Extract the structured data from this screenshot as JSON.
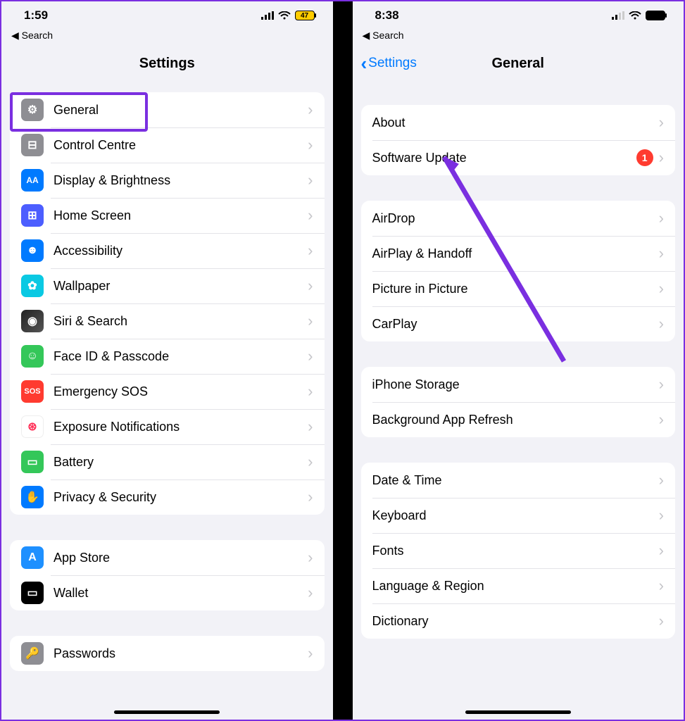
{
  "left": {
    "status": {
      "time": "1:59",
      "battery_label": "47"
    },
    "back_search": "◀ Search",
    "title": "Settings",
    "sections": [
      [
        {
          "label": "General",
          "icon": "gear"
        },
        {
          "label": "Control Centre",
          "icon": "cc"
        },
        {
          "label": "Display & Brightness",
          "icon": "disp"
        },
        {
          "label": "Home Screen",
          "icon": "home"
        },
        {
          "label": "Accessibility",
          "icon": "acc"
        },
        {
          "label": "Wallpaper",
          "icon": "wall"
        },
        {
          "label": "Siri & Search",
          "icon": "siri"
        },
        {
          "label": "Face ID & Passcode",
          "icon": "face"
        },
        {
          "label": "Emergency SOS",
          "icon": "sos"
        },
        {
          "label": "Exposure Notifications",
          "icon": "expo"
        },
        {
          "label": "Battery",
          "icon": "batt"
        },
        {
          "label": "Privacy & Security",
          "icon": "priv"
        }
      ],
      [
        {
          "label": "App Store",
          "icon": "app"
        },
        {
          "label": "Wallet",
          "icon": "wallet"
        }
      ],
      [
        {
          "label": "Passwords",
          "icon": "pass"
        }
      ]
    ]
  },
  "right": {
    "status": {
      "time": "8:38"
    },
    "back_search": "◀ Search",
    "back_button": "Settings",
    "title": "General",
    "badge_count": "1",
    "sections": [
      [
        {
          "label": "About"
        },
        {
          "label": "Software Update",
          "badge": true
        }
      ],
      [
        {
          "label": "AirDrop"
        },
        {
          "label": "AirPlay & Handoff"
        },
        {
          "label": "Picture in Picture"
        },
        {
          "label": "CarPlay"
        }
      ],
      [
        {
          "label": "iPhone Storage"
        },
        {
          "label": "Background App Refresh"
        }
      ],
      [
        {
          "label": "Date & Time"
        },
        {
          "label": "Keyboard"
        },
        {
          "label": "Fonts"
        },
        {
          "label": "Language & Region"
        },
        {
          "label": "Dictionary"
        }
      ]
    ]
  },
  "icon_glyphs": {
    "gear": "⚙︎",
    "cc": "⊟",
    "disp": "AA",
    "home": "⊞",
    "acc": "☻",
    "wall": "✿",
    "siri": "◉",
    "face": "☺",
    "sos": "SOS",
    "expo": "⊛",
    "batt": "▭",
    "priv": "✋",
    "app": "A",
    "wallet": "▭",
    "pass": "🔑"
  }
}
